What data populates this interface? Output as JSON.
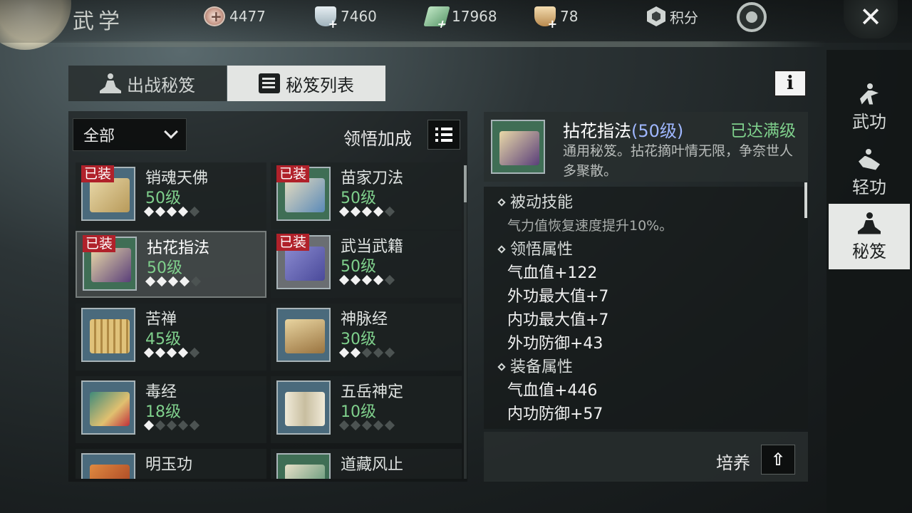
{
  "header": {
    "title": "武学",
    "resources": [
      {
        "icon": "coin-plus-icon",
        "value": "4477"
      },
      {
        "icon": "silver-bowl-icon",
        "value": "7460"
      },
      {
        "icon": "jade-ticket-icon",
        "value": "17968"
      },
      {
        "icon": "gold-bowl-icon",
        "value": "78"
      }
    ],
    "score_label": "积分"
  },
  "tabs": {
    "battle": "出战秘笈",
    "list": "秘笈列表"
  },
  "filter": {
    "selected": "全部",
    "bonus_label": "领悟加成"
  },
  "equip_tag": "已装",
  "books": [
    {
      "name": "销魂天佛",
      "level": "50级",
      "stars": 4,
      "equipped": true
    },
    {
      "name": "苗家刀法",
      "level": "50级",
      "stars": 4,
      "equipped": true
    },
    {
      "name": "拈花指法",
      "level": "50级",
      "stars": 4,
      "equipped": true,
      "selected": true
    },
    {
      "name": "武当武籍",
      "level": "50级",
      "stars": 4,
      "equipped": true
    },
    {
      "name": "苦禅",
      "level": "45级",
      "stars": 4,
      "equipped": false
    },
    {
      "name": "神脉经",
      "level": "30级",
      "stars": 2,
      "equipped": false
    },
    {
      "name": "毒经",
      "level": "18级",
      "stars": 1,
      "equipped": false
    },
    {
      "name": "五岳神定",
      "level": "10级",
      "stars": 0,
      "equipped": false
    },
    {
      "name": "明玉功",
      "level": "",
      "stars": 0,
      "equipped": false
    },
    {
      "name": "道藏风止",
      "level": "",
      "stars": 0,
      "equipped": false
    }
  ],
  "detail": {
    "name": "拈花指法",
    "level": "(50级)",
    "status": "已达满级",
    "description": "通用秘笈。拈花摘叶情无限，争奈世人多聚散。",
    "passive_title": "被动技能",
    "passive_text": "气力值恢复速度提升10%。",
    "comprehend_title": "领悟属性",
    "comprehend_lines": [
      "气血值+122",
      "外功最大值+7",
      "内功最大值+7",
      "外功防御+43"
    ],
    "equip_title": "装备属性",
    "equip_lines": [
      "气血值+446",
      "内功防御+57"
    ],
    "cultivate_label": "培养"
  },
  "sidenav": {
    "items": [
      {
        "label": "武功",
        "icon": "martial-pose-icon"
      },
      {
        "label": "轻功",
        "icon": "lightness-pose-icon"
      },
      {
        "label": "秘笈",
        "icon": "meditation-icon",
        "active": true
      }
    ]
  },
  "colors": {
    "level_green": "#7fd08c",
    "equip_red": "#b0212a",
    "detail_level_blue": "#9fb7ff"
  }
}
